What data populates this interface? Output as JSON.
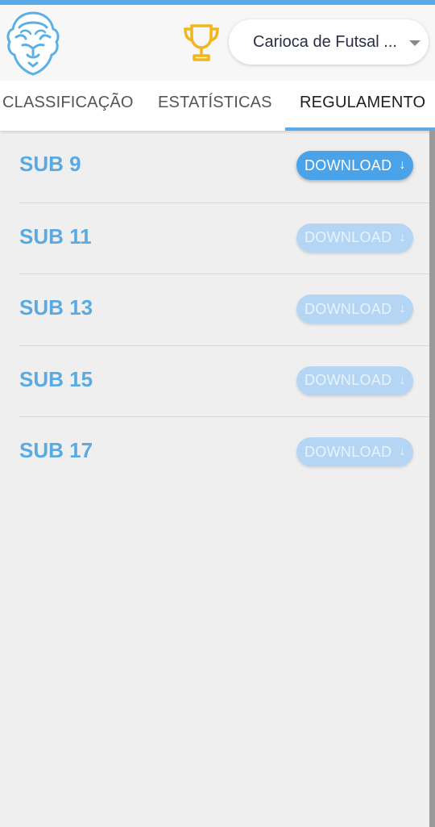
{
  "header": {
    "logo_icon": "lion-logo-icon",
    "trophy_icon": "trophy-icon",
    "competition_select": {
      "value": "Carioca de Futsal ..."
    },
    "accent_color": "#5aa9e8"
  },
  "tabs": [
    {
      "label": "CLASSIFICAÇÃO",
      "selected": false
    },
    {
      "label": "ESTATÍSTICAS",
      "selected": false
    },
    {
      "label": "REGULAMENTO",
      "selected": true
    }
  ],
  "regulations": [
    {
      "title": "SUB 9",
      "button_label": "DOWNLOAD",
      "enabled": true
    },
    {
      "title": "SUB 11",
      "button_label": "DOWNLOAD",
      "enabled": false
    },
    {
      "title": "SUB 13",
      "button_label": "DOWNLOAD",
      "enabled": false
    },
    {
      "title": "SUB 15",
      "button_label": "DOWNLOAD",
      "enabled": false
    },
    {
      "title": "SUB 17",
      "button_label": "DOWNLOAD",
      "enabled": false
    }
  ],
  "download_arrow": "↓"
}
